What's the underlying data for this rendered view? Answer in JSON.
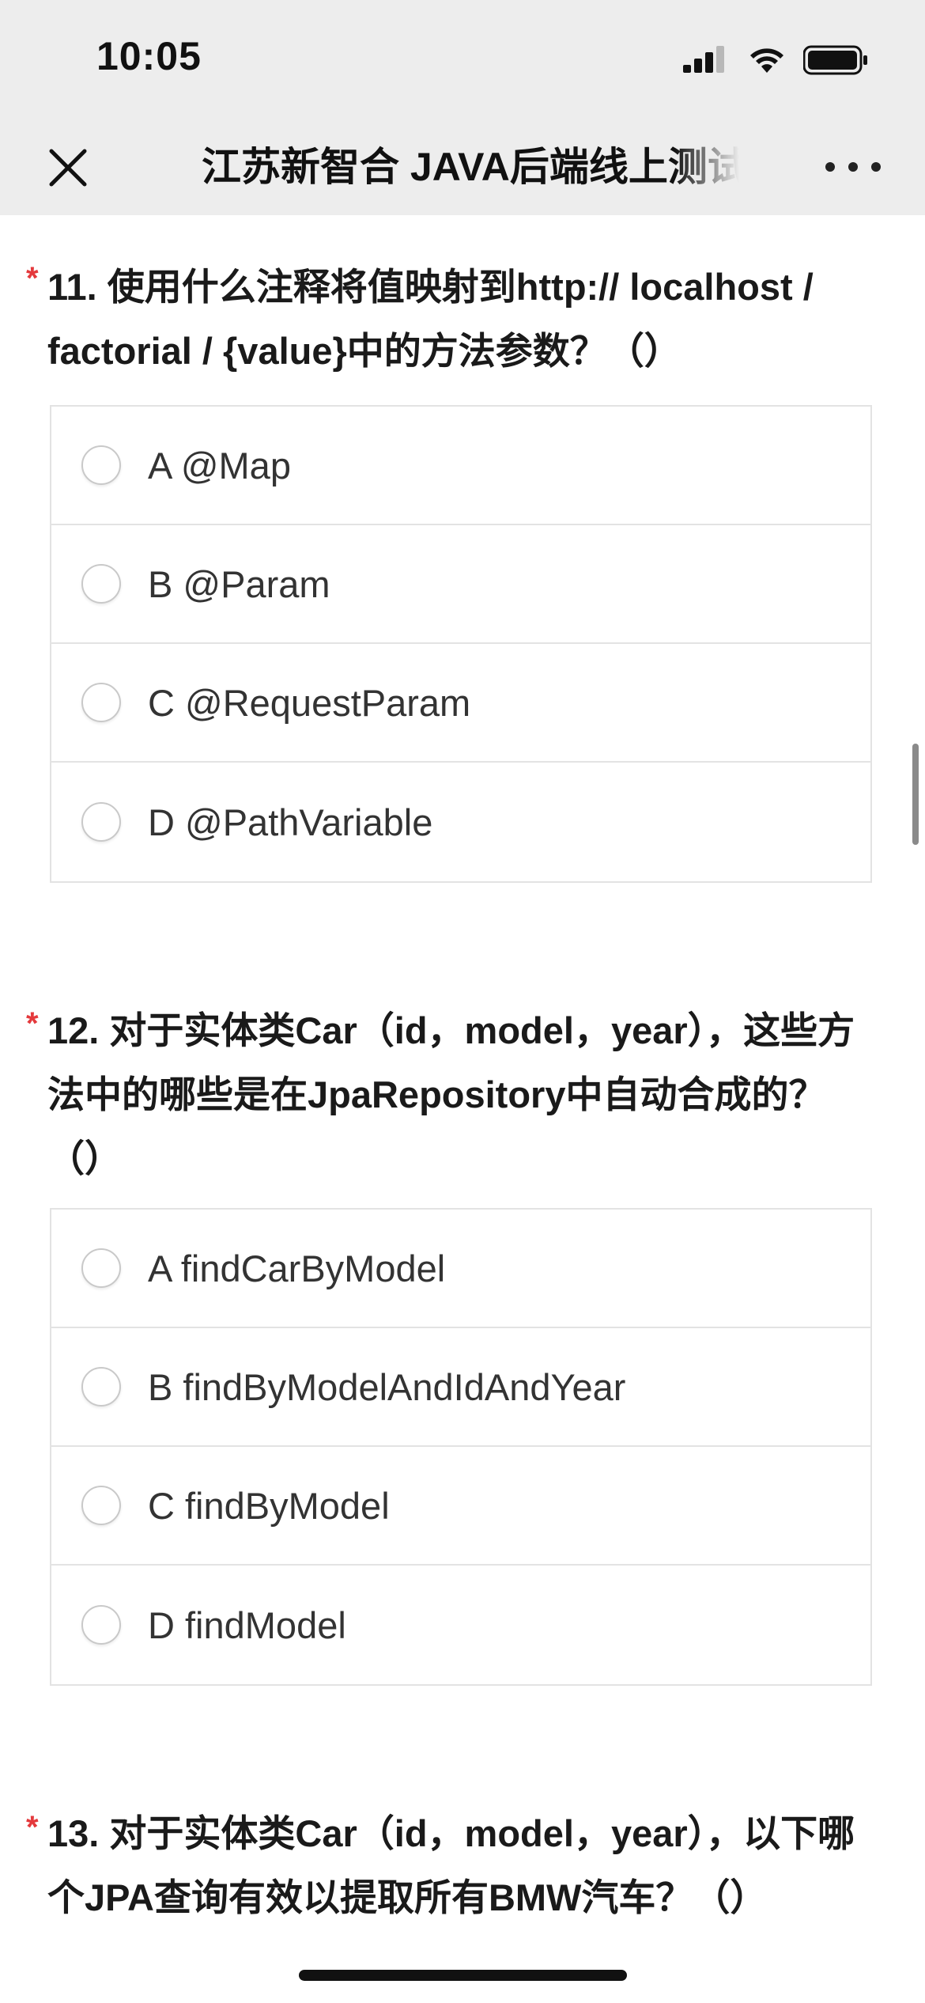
{
  "status_bar": {
    "time": "10:05"
  },
  "nav": {
    "title": "江苏新智合 JAVA后端线上测试",
    "close_icon": "close-icon",
    "more_icon": "more-icon"
  },
  "questions": [
    {
      "number": "11.",
      "required_mark": "*",
      "title": "11. 使用什么注释将值映射到http:// localhost / factorial / {value}中的方法参数？（）",
      "options": [
        {
          "label": "A @Map"
        },
        {
          "label": "B @Param"
        },
        {
          "label": "C @RequestParam"
        },
        {
          "label": "D @PathVariable"
        }
      ]
    },
    {
      "number": "12.",
      "required_mark": "*",
      "title": "12. 对于实体类Car（id，model，year），这些方法中的哪些是在JpaRepository中自动合成的？（）",
      "options": [
        {
          "label": "A findCarByModel"
        },
        {
          "label": "B findByModelAndIdAndYear"
        },
        {
          "label": "C findByModel"
        },
        {
          "label": "D findModel"
        }
      ]
    },
    {
      "number": "13.",
      "required_mark": "*",
      "title": "13. 对于实体类Car（id，model，year），以下哪个JPA查询有效以提取所有BMW汽车？（）"
    }
  ],
  "colors": {
    "required": "#e4393c",
    "header_bg": "#ededed",
    "border": "#e3e3e3"
  }
}
